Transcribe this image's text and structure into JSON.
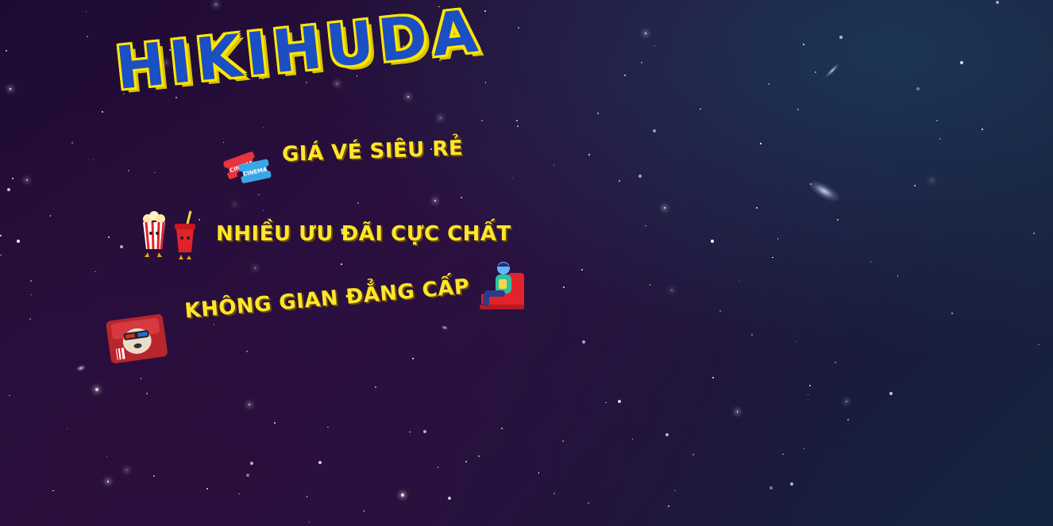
{
  "brand": {
    "title": "HIKIHUDA"
  },
  "features": [
    {
      "label": "Giá vé siêu rẻ",
      "icon": "cinema-ticket-icon"
    },
    {
      "label": "Nhiều ưu đãi cực chất",
      "icon": "popcorn-and-drink-icon"
    },
    {
      "label": "Không gian đẳng cấp",
      "icon": "moviegoer-in-seat-icon"
    }
  ],
  "decorations": {
    "sticker": "dog-with-3d-glasses-icon"
  },
  "colors": {
    "background": "#241038",
    "brand_fill": "#1b4fc4",
    "brand_outline": "#ffe600",
    "feature_text": "#ffe629"
  }
}
